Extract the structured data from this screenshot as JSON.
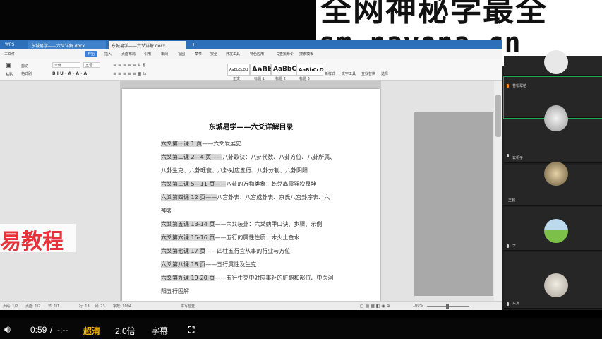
{
  "watermark": {
    "line1": "全网神秘学最全",
    "line2": "sm.nayona.cn"
  },
  "wps": {
    "tabs": [
      "WPS",
      "东城易学——六爻详解.docx",
      "东城易学——六爻详解.docx"
    ],
    "menu": [
      "三文件",
      "开始",
      "插入",
      "页面布局",
      "引用",
      "审阅",
      "视图",
      "章节",
      "安全",
      "开发工具",
      "特色应用",
      "Q查找命令",
      "搜索模板"
    ],
    "ribbon": {
      "paste": "粘贴",
      "cut": "剪切",
      "format_painter": "格式刷",
      "font": "宋体",
      "size": "五号",
      "styles": [
        "AaBbCcDd",
        "AaBb",
        "AaBbC",
        "AaBbCcD"
      ],
      "style_labels": [
        "正文",
        "标题 1",
        "标题 2",
        "标题 3"
      ],
      "new_style": "新样式",
      "text_tools": "文字工具",
      "find_replace": "查找替换",
      "select": "选择"
    },
    "document": {
      "title": "东城易学——六爻详解目录",
      "lines": [
        {
          "hl": "六爻第一课 1 页",
          "rest": "——六爻发展史"
        },
        {
          "hl": "六爻第二课 2—4 页——",
          "rest": "八卦歌诀：八卦代数、八卦方位、八卦所属、"
        },
        {
          "hl": "",
          "rest": "八卦生克、八卦旺衰、八卦对应五行、八卦分割、八卦阴阳"
        },
        {
          "hl": "六爻第三课 5—11 页——",
          "rest": "八卦的万物类象：乾兑离震巽坎艮坤"
        },
        {
          "hl": "六爻第四课 12 页——",
          "rest": "八宫卦表：八宫成卦表、京氏八宫卦序表、六"
        },
        {
          "hl": "",
          "rest": "神表"
        },
        {
          "hl": "六爻第五课 13-14 页",
          "rest": "——六爻装卦：六爻纳甲口诀、步骤、示例"
        },
        {
          "hl": "六爻第六课 15-16 页",
          "rest": "——五行的属性性质：木火土金水"
        },
        {
          "hl": "六爻第七课 17 页",
          "rest": "——四柱五行宜从事的行业与方位"
        },
        {
          "hl": "六爻第八课 18 页",
          "rest": "——五行属性及生克"
        },
        {
          "hl": "六爻第九课 19-20 页",
          "rest": "——五行生克中对应事补的脏腑和部位、中医洞"
        },
        {
          "hl": "",
          "rest": "阳五行图解"
        },
        {
          "hl": "六爻第十课 21-22 页",
          "rest": "——六爻中爻位代表意义"
        }
      ]
    },
    "overlay": "易教程",
    "status": {
      "page": "页码: 1/2",
      "pages": "页面: 1/2",
      "section": "节: 1/1",
      "row": "行: 13",
      "col": "列: 23",
      "chars": "字数: 1094",
      "spell": "拼写检查",
      "zoom": "100%"
    }
  },
  "participants": [
    {
      "name": "",
      "avatar": "partial"
    },
    {
      "name": "苍松翠柏",
      "avatar": "gray"
    },
    {
      "name": "玄机子",
      "avatar": "photo"
    },
    {
      "name": "王毅",
      "avatar": "beige"
    },
    {
      "name": "李",
      "avatar": "landscape"
    },
    {
      "name": "东篱",
      "avatar": "light"
    }
  ],
  "player": {
    "volume_icon": "speaker-icon",
    "time": "0:59",
    "separator": "/",
    "duration": "-:--",
    "quality": "超清",
    "speed": "2.0倍",
    "subtitle": "字幕",
    "fullscreen_icon": "fullscreen-icon"
  }
}
